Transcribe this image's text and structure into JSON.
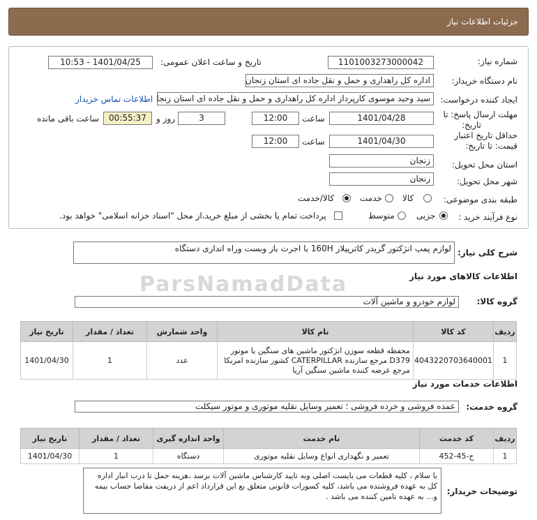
{
  "header": {
    "title": "جزئیات اطلاعات نیاز"
  },
  "form": {
    "need_number_label": "شماره نیاز:",
    "need_number": "1101003273000042",
    "announce_label": "تاریخ و ساعت اعلان عمومی:",
    "announce_value": "1401/04/25 - 10:53",
    "buyer_label": "نام دستگاه خریدار:",
    "buyer_value": "اداره کل راهداری و حمل و نقل جاده ای استان زنجان",
    "creator_label": "ایجاد کننده درخواست:",
    "creator_value": "سید وحید موسوی کارپرداز اداره کل راهداری و حمل و نقل جاده ای استان زنجان",
    "contact_link": "اطلاعات تماس خریدار",
    "deadline_label_1": "مهلت ارسال پاسخ: تا",
    "deadline_label_2": "تاریخ:",
    "deadline_date": "1401/04/28",
    "time_label": "ساعت",
    "deadline_time": "12:00",
    "days_value": "3",
    "days_label": "روز و",
    "remaining_value": "00:55:37",
    "remaining_label": "ساعت باقی مانده",
    "validity_label_1": "حداقل تاریخ اعتبار",
    "validity_label_2": "قیمت: تا تاریخ:",
    "validity_date": "1401/04/30",
    "validity_time": "12:00",
    "province_label": "استان محل تحویل:",
    "province_value": "زنجان",
    "city_label": "شهر محل تحویل:",
    "city_value": "زنجان",
    "category_label": "طبقه بندی موضوعی:",
    "category_options": [
      "کالا",
      "خدمت",
      "کالا/خدمت"
    ],
    "category_selected": "کالا/خدمت",
    "process_label": "نوع فرآیند خرید :",
    "process_options": [
      "جزیی",
      "متوسط"
    ],
    "process_selected": "جزیی",
    "treasury_text": "پرداخت تمام یا بخشی از مبلغ خرید،از محل \"اسناد خزانه اسلامی\" خواهد بود."
  },
  "summary": {
    "label": "شرح کلی نیاز:",
    "value": "لوازم پمپ انژکتور گریدر کاترپیلار 160H با اجرت باز وبست وراه اندازی دستگاه"
  },
  "goods": {
    "section_title": "اطلاعات کالاهای مورد نیاز",
    "group_label": "گروه کالا:",
    "group_value": "لوازم خودرو و ماشین آلات",
    "columns": [
      "ردیف",
      "کد کالا",
      "نام کالا",
      "واحد شمارش",
      "تعداد / مقدار",
      "تاریخ نیاز"
    ],
    "rows": [
      {
        "row": "1",
        "code": "4043220703640001",
        "name": "محفظه قطعه سوزن انژکتور ماشین های سنگین یا موتور D379 مرجع سازنده CATERPILLAR کشور سازنده امریکا مرجع عرضه کننده ماشین سنگین آریا",
        "unit": "عدد",
        "qty": "1",
        "date": "1401/04/30"
      }
    ]
  },
  "services": {
    "section_title": "اطلاعات خدمات مورد نیاز",
    "group_label": "گروه خدمت:",
    "group_value": "عمده فروشی و خرده فروشی ؛ تعمیر وسایل نقلیه موتوری و موتور سیکلت",
    "columns": [
      "ردیف",
      "کد خدمت",
      "نام خدمت",
      "واحد اندازه گیری",
      "تعداد / مقدار",
      "تاریخ نیاز"
    ],
    "rows": [
      {
        "row": "1",
        "code": "ج-45-452",
        "name": "تعمیر و نگهداری انواع وسایل نقلیه موتوری",
        "unit": "دستگاه",
        "qty": "1",
        "date": "1401/04/30"
      }
    ]
  },
  "buyer_notes": {
    "label": "توضیحات خریدار:",
    "text": "با سلام ، کلیه قطعات می بایست اصلی وبه تایید کارشناس ماشین آلات برسد ،هزینه حمل تا درب انبار اداره کل به عهده فروشنده می باشد، کلیه کسورات قانونی متعلق بع این قرارداد اعم از دریفت مفاصا حساب بیمه و... به عهده تامین کننده می باشد ."
  },
  "watermark": {
    "text": "ParsNamadData"
  }
}
